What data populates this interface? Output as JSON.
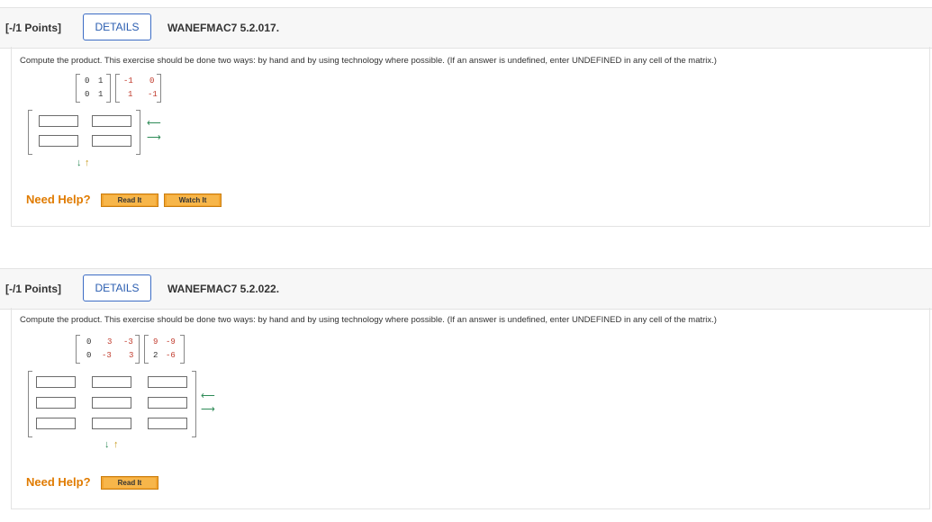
{
  "q1": {
    "points": "[-/1 Points]",
    "details": "DETAILS",
    "code": "WANEFMAC7 5.2.017.",
    "prompt": "Compute the product. This exercise should be done two ways: by hand and by using technology where possible. (If an answer is undefined, enter UNDEFINED in any cell of the matrix.)",
    "matrixA": [
      [
        "0",
        "1"
      ],
      [
        "0",
        "1"
      ]
    ],
    "matrixB": [
      [
        "-1",
        "0"
      ],
      [
        "1",
        "-1"
      ]
    ],
    "need_help": "Need Help?",
    "read_it": "Read It",
    "watch_it": "Watch It"
  },
  "q2": {
    "points": "[-/1 Points]",
    "details": "DETAILS",
    "code": "WANEFMAC7 5.2.022.",
    "prompt": "Compute the product. This exercise should be done two ways: by hand and by using technology where possible. (If an answer is undefined, enter UNDEFINED in any cell of the matrix.)",
    "matrixA": [
      [
        "0",
        "3",
        "-3"
      ],
      [
        "0",
        "-3",
        "3"
      ]
    ],
    "matrixB": [
      [
        "9",
        "-9"
      ],
      [
        "2",
        "-6"
      ]
    ],
    "need_help": "Need Help?",
    "read_it": "Read It"
  },
  "icons": {
    "arrow_left": "⟵",
    "arrow_right": "⟶",
    "arrow_down": "↓",
    "arrow_up": "↑"
  },
  "colors": {
    "need_help": "#e07b00",
    "button": "#f3a530",
    "details_border": "#3d6dc5",
    "matrix_red": "#c0392b"
  }
}
